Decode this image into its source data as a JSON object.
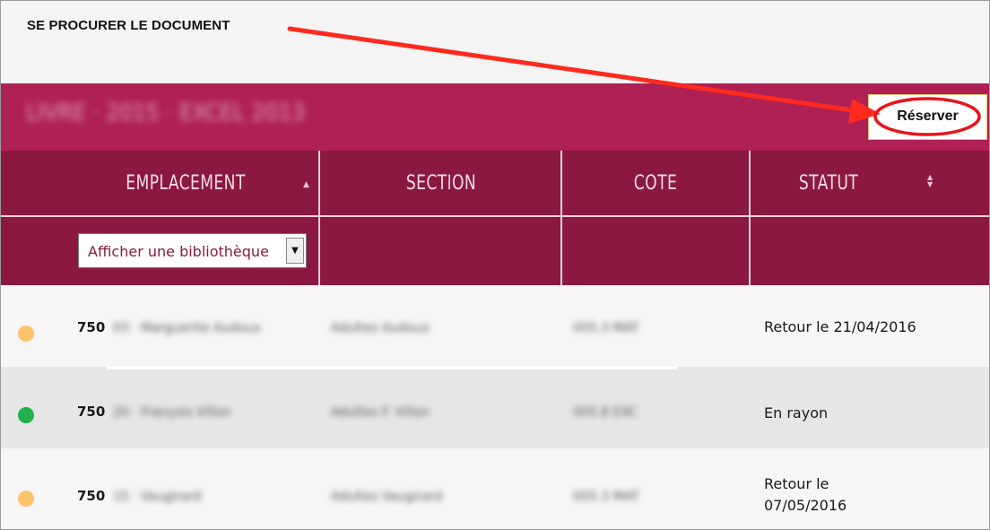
{
  "header": {
    "heading": "SE PROCURER LE DOCUMENT"
  },
  "title_band": {
    "document_title": "LIVRE · 2015 · EXCEL 2013",
    "reserve_label": "Réserver",
    "accent_color": "#af2055"
  },
  "table": {
    "header_color": "#8b1840",
    "columns": [
      {
        "label": "EMPLACEMENT",
        "sort_icon": "sort-asc-icon"
      },
      {
        "label": "SECTION"
      },
      {
        "label": "COTE"
      },
      {
        "label": "STATUT",
        "sort_icon": "sort-both-icon"
      }
    ],
    "filter": {
      "selected": "Afficher une bibliothèque"
    },
    "rows": [
      {
        "status_color": "#fdc36b",
        "location": "750",
        "location_rest": "03 · Marguerite Audoux",
        "section": "Adultes Audoux",
        "cote": "005.3 MAT",
        "status": "Retour le 21/04/2016"
      },
      {
        "status_color": "#22b14c",
        "location": "750",
        "location_rest": "20 · François Villon",
        "section": "Adultes F. Villon",
        "cote": "005.8 EXC",
        "status": "En rayon"
      },
      {
        "status_color": "#fdc36b",
        "location": "750",
        "location_rest": "15 · Vaugirard",
        "section": "Adultes Vaugirard",
        "cote": "005.3 MAT",
        "status_line1": "Retour le",
        "status_line2": "07/05/2016"
      }
    ]
  }
}
